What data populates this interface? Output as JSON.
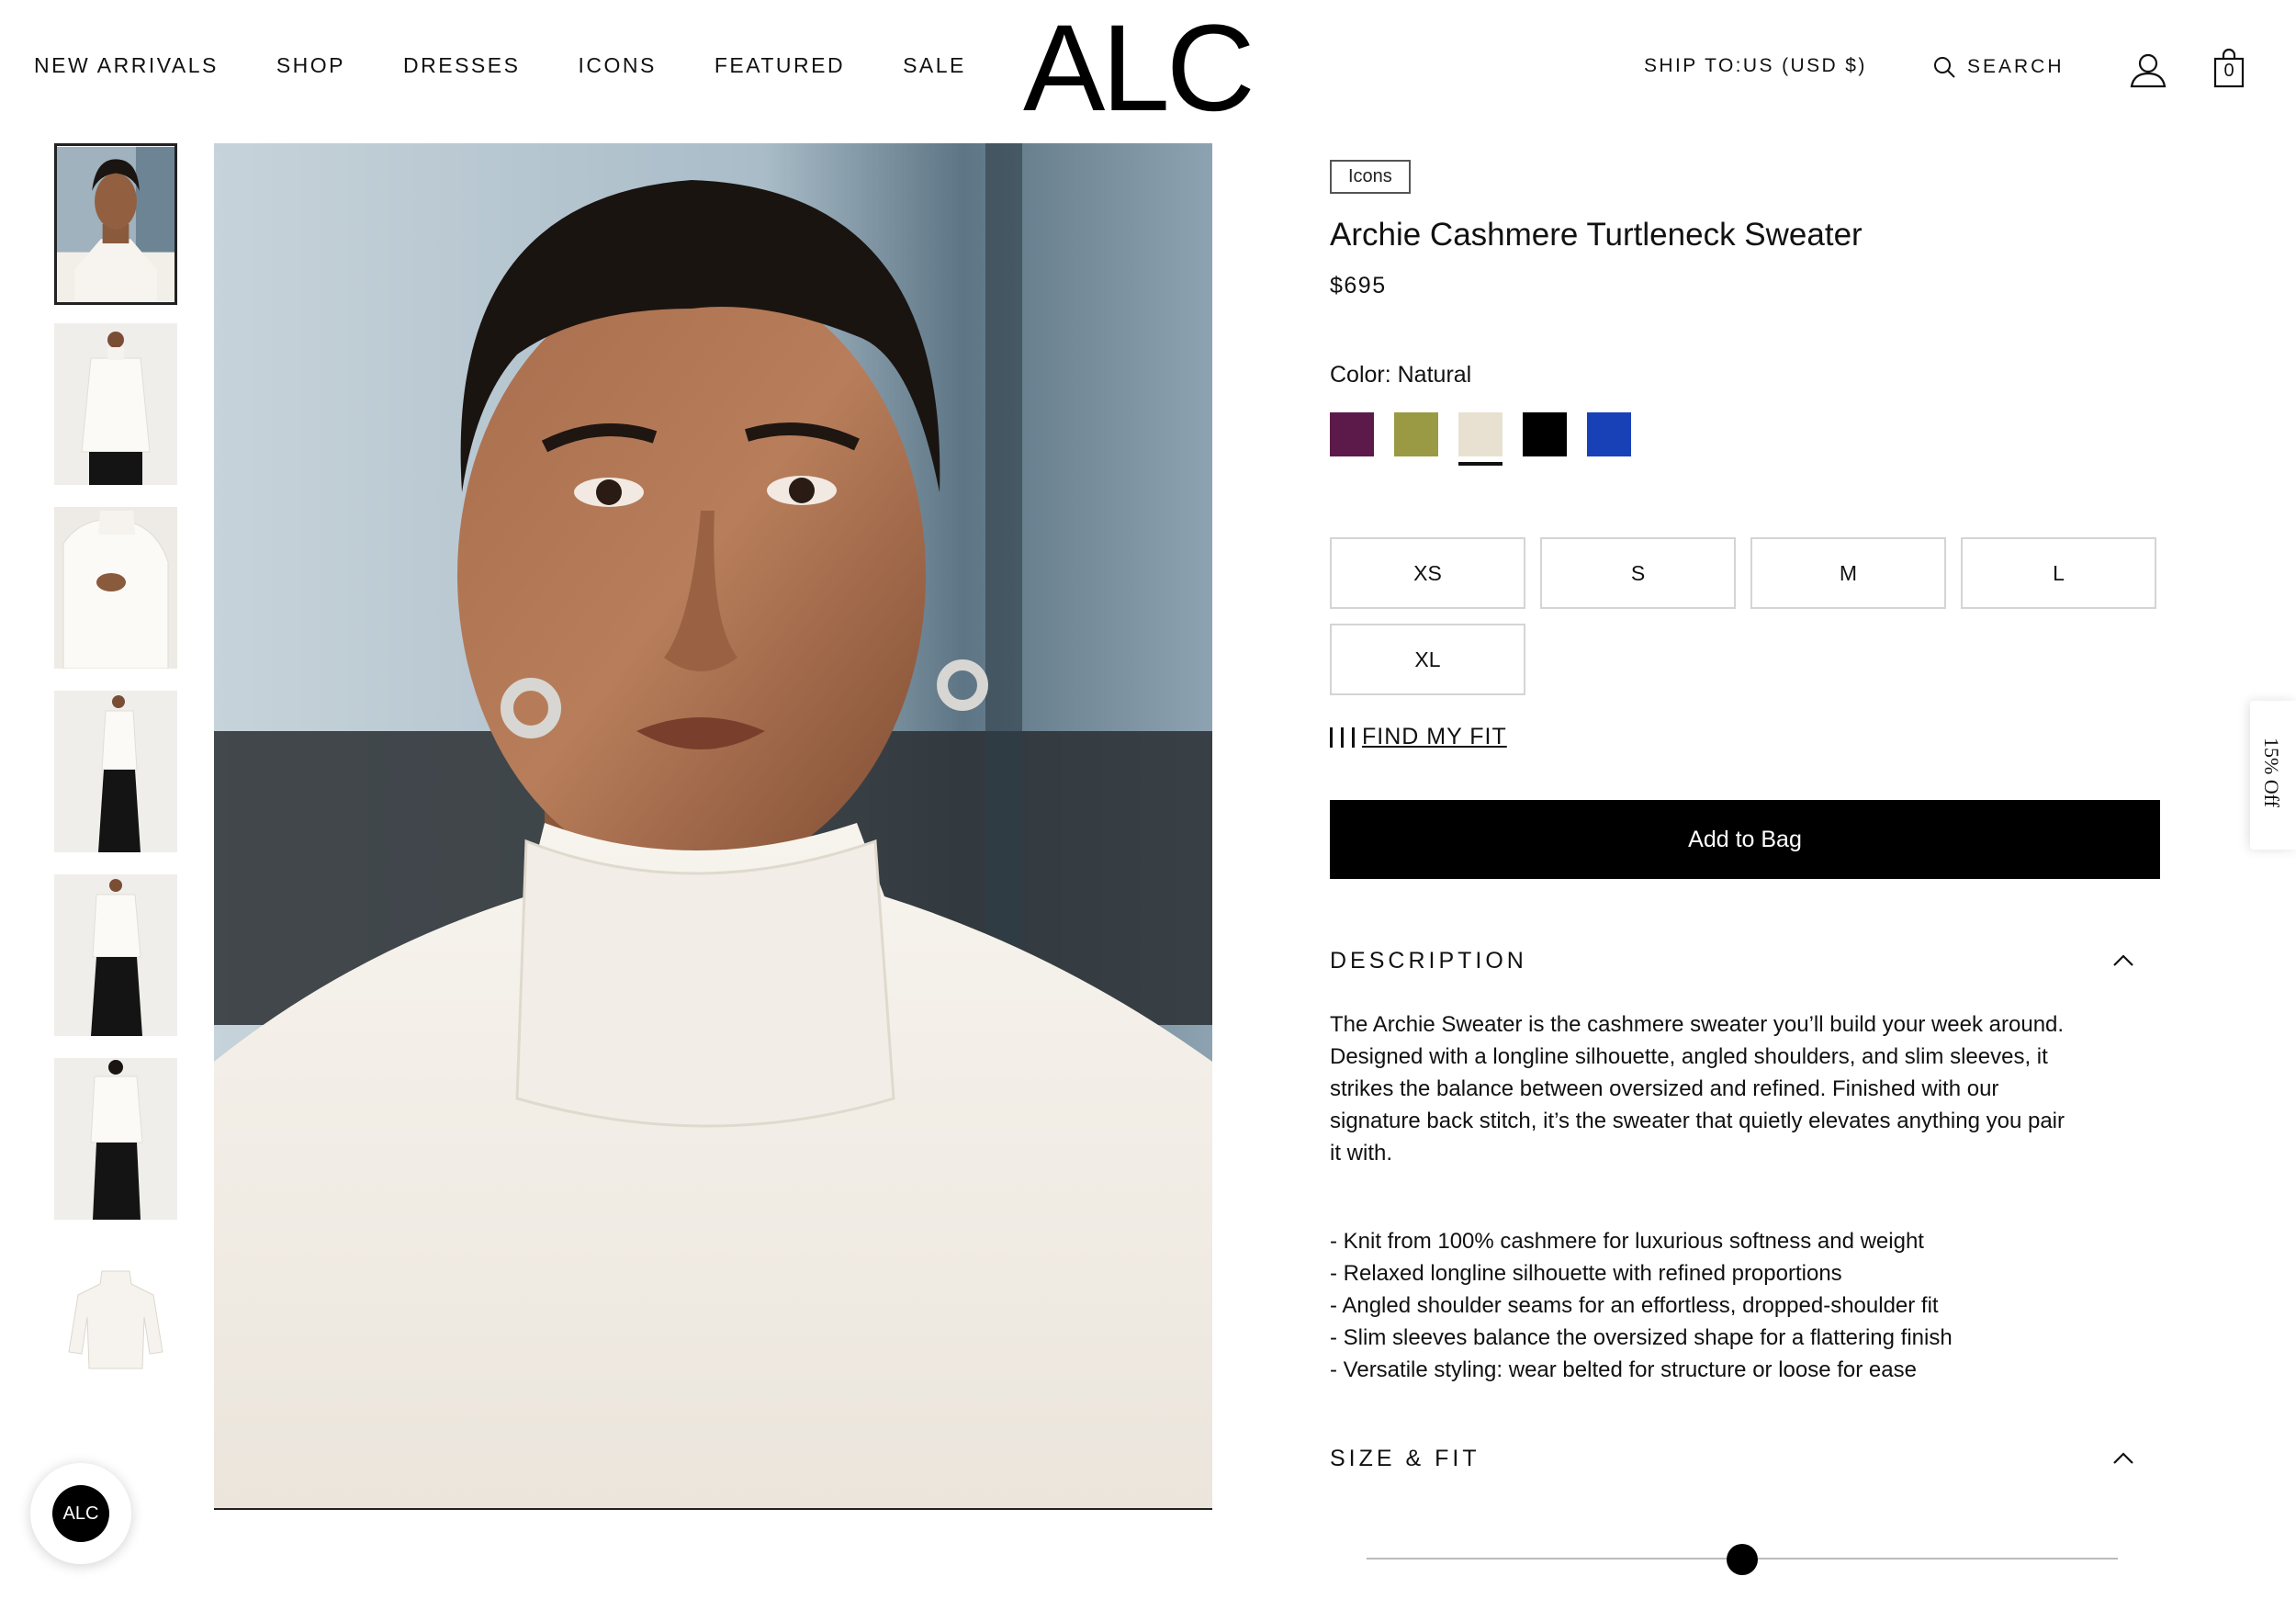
{
  "header": {
    "nav": [
      "NEW ARRIVALS",
      "SHOP",
      "DRESSES",
      "ICONS",
      "FEATURED",
      "SALE"
    ],
    "logo": "ALC",
    "ship_to": "SHIP TO:US (USD $)",
    "search_label": "SEARCH",
    "bag_count": "0"
  },
  "gallery": {
    "thumbnail_icons": [
      "model-face-closeup-thumb",
      "model-full-front-thumb",
      "model-sleeve-detail-thumb",
      "model-side-profile-thumb",
      "model-hands-in-pockets-thumb",
      "model-back-view-thumb",
      "sweater-flat-lay-thumb"
    ],
    "active_index": 0
  },
  "product": {
    "collection_tag": "Icons",
    "title": "Archie Cashmere Turtleneck Sweater",
    "price": "$695",
    "color_label": "Color: Natural",
    "colors": [
      "#5c1a4a",
      "#9b9a44",
      "#e8e1d2",
      "#000000",
      "#1841b8"
    ],
    "selected_color_index": 2,
    "sizes": [
      "XS",
      "S",
      "M",
      "L",
      "XL"
    ],
    "find_fit": "FIND MY FIT",
    "add_to_bag": "Add to Bag"
  },
  "description": {
    "heading": "DESCRIPTION",
    "lines": [
      "The Archie Sweater is the cashmere sweater you’ll build your week around.",
      "Designed with a longline silhouette, angled shoulders, and slim sleeves, it",
      "strikes the balance between oversized and refined. Finished with our",
      "signature back stitch, it’s the sweater that quietly elevates anything you pair",
      "it with."
    ],
    "bullets": [
      "- Knit from 100% cashmere for luxurious softness and weight",
      "- Relaxed longline silhouette with refined proportions",
      "- Angled shoulder seams for an effortless, dropped-shoulder fit",
      "- Slim sleeves balance the oversized shape for a flattering finish",
      "- Versatile styling: wear belted for structure or loose for ease"
    ]
  },
  "size_fit": {
    "heading": "SIZE & FIT",
    "slider_value": 0.5
  },
  "side_tab": "15% Off",
  "chat_badge": "ALC"
}
